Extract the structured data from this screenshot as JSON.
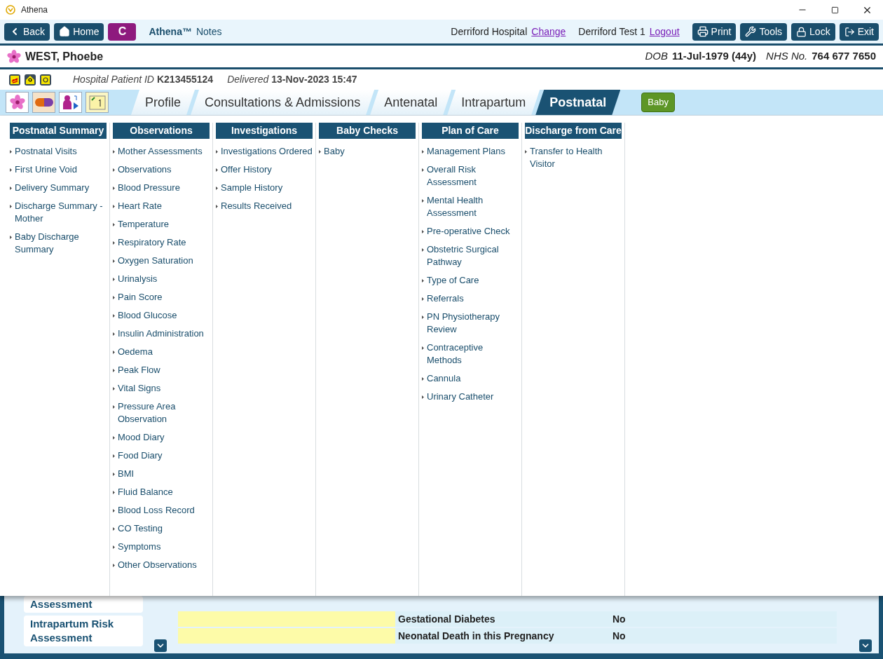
{
  "window": {
    "title": "Athena"
  },
  "toolbar": {
    "buttons": [
      {
        "label": "Back",
        "kind": "back"
      },
      {
        "label": "Home",
        "kind": "home"
      },
      {
        "label": "C",
        "kind": "letter"
      }
    ],
    "app_name": "Athena™",
    "app_sub": "Notes",
    "hospital": "Derriford Hospital",
    "change_link": "Change",
    "user": "Derriford Test 1",
    "logout_link": "Logout",
    "actions": [
      {
        "label": "Print",
        "kind": "print"
      },
      {
        "label": "Tools",
        "kind": "tools"
      },
      {
        "label": "Lock",
        "kind": "lock"
      },
      {
        "label": "Exit",
        "kind": "exit"
      }
    ]
  },
  "patient": {
    "name": "WEST, Phoebe",
    "dob_label": "DOB",
    "dob": "11-Jul-1979 (44y)",
    "nhs_label": "NHS No.",
    "nhs": "764 677 7650",
    "id_label": "Hospital Patient ID",
    "id": "K213455124",
    "delivered_label": "Delivered",
    "delivered": "13-Nov-2023 15:47"
  },
  "tabs": [
    {
      "label": "Profile",
      "selected": false
    },
    {
      "label": "Consultations & Admissions",
      "selected": false
    },
    {
      "label": "Antenatal",
      "selected": false
    },
    {
      "label": "Intrapartum",
      "selected": false
    },
    {
      "label": "Postnatal",
      "selected": true
    }
  ],
  "baby_button": "Baby",
  "menu_columns": [
    {
      "title": "Postnatal Summary",
      "items": [
        "Postnatal Visits",
        "First Urine Void",
        "Delivery Summary",
        "Discharge Summary - Mother",
        "Baby Discharge Summary"
      ]
    },
    {
      "title": "Observations",
      "items": [
        "Mother Assessments",
        "Observations",
        "Blood Pressure",
        "Heart Rate",
        "Temperature",
        "Respiratory Rate",
        "Oxygen Saturation",
        "Urinalysis",
        "Pain Score",
        "Blood Glucose",
        "Insulin Administration",
        "Oedema",
        "Peak Flow",
        "Vital Signs",
        "Pressure Area Observation",
        "Mood Diary",
        "Food Diary",
        "BMI",
        "Fluid Balance",
        "Blood Loss Record",
        "CO Testing",
        "Symptoms",
        "Other Observations"
      ]
    },
    {
      "title": "Investigations",
      "items": [
        "Investigations Ordered",
        "Offer History",
        "Sample History",
        "Results Received"
      ]
    },
    {
      "title": "Baby Checks",
      "items": [
        "Baby"
      ]
    },
    {
      "title": "Plan of Care",
      "items": [
        "Management Plans",
        "Overall Risk Assessment",
        "Mental Health Assessment",
        "Pre-operative Check",
        "Obstetric Surgical Pathway",
        "Type of Care",
        "Referrals",
        "PN Physiotherapy Review",
        "Contraceptive Methods",
        "Cannula",
        "Urinary Catheter"
      ]
    },
    {
      "title": "Discharge from Care",
      "items": [
        "Transfer to Health Visitor"
      ]
    }
  ],
  "background": {
    "side_items": [
      "Assessment",
      "Intrapartum Risk Assessment"
    ],
    "rows": [
      {
        "label": "Gestational Diabetes",
        "value": "No"
      },
      {
        "label": "Neonatal Death in this Pregnancy",
        "value": "No"
      }
    ]
  }
}
